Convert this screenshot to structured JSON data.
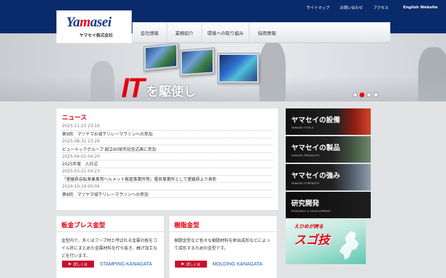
{
  "utility_nav": {
    "sitemap": "サイトマップ",
    "contact": "お問い合わせ",
    "access": "アクセス",
    "english": "English Website"
  },
  "logo": {
    "word_a": "Ya",
    "word_b": "m",
    "word_c": "asei",
    "company": "ヤマセイ株式会社"
  },
  "global_nav": [
    "会社情報",
    "業務紹介",
    "環境への取り組み",
    "採用情報"
  ],
  "hero": {
    "title_it": "IT",
    "title_rest": "を駆使し",
    "slide_count": 4,
    "active_slide": 1
  },
  "news": {
    "heading": "ニュース",
    "items": [
      {
        "date": "2025-11-23 23:16",
        "text": "第9回　マツヤマお城下リレーマラソンへの参加"
      },
      {
        "date": "2025-08-31 23:26",
        "text": "ピューテックグループ 創立60周年記念式典に参加"
      },
      {
        "date": "2025-04-01 04:20",
        "text": "2025年度　入社式"
      },
      {
        "date": "2025-03-21 04:23",
        "text": "「愛媛県自転車乗車用ヘルメット推進事業所等」優良事業所として愛媛県より表彰"
      },
      {
        "date": "2024-10-14 00:04",
        "text": "第8回　マツヤマ城下リレーマラソンへの参加"
      }
    ]
  },
  "cards": [
    {
      "title": "板金プレス金型",
      "desc": "金型内で、多くはフープ材と呼ばれる金属の板をコイル状にまとめた金属材料を打ち抜き、曲げ加工などを行います。",
      "button": "詳しくは",
      "en": "STAMPING KANAGATA"
    },
    {
      "title": "樹脂金型",
      "desc": "樹脂金型など色々な樹脂材料を射出成形などによって成形するための金型です。",
      "button": "詳しくは",
      "en": "MOLDING KANAGATA"
    }
  ],
  "side_links": [
    {
      "jp": "ヤマセイの設備",
      "en": "YAMASEI TOOLS"
    },
    {
      "jp": "ヤマセイの製品",
      "en": "YAMASEI PRODUCTS"
    },
    {
      "jp": "ヤマセイの強み",
      "en": "YAMASEI STRENGTH"
    },
    {
      "jp": "研究開発",
      "en": "RESEARCH & DEVELOPMENT"
    }
  ],
  "banner": {
    "small": "えひめが誇る",
    "big": "スゴ技"
  },
  "colors": {
    "navy": "#0a2b6b",
    "red": "#e60012",
    "link_blue": "#1a5ea8"
  }
}
